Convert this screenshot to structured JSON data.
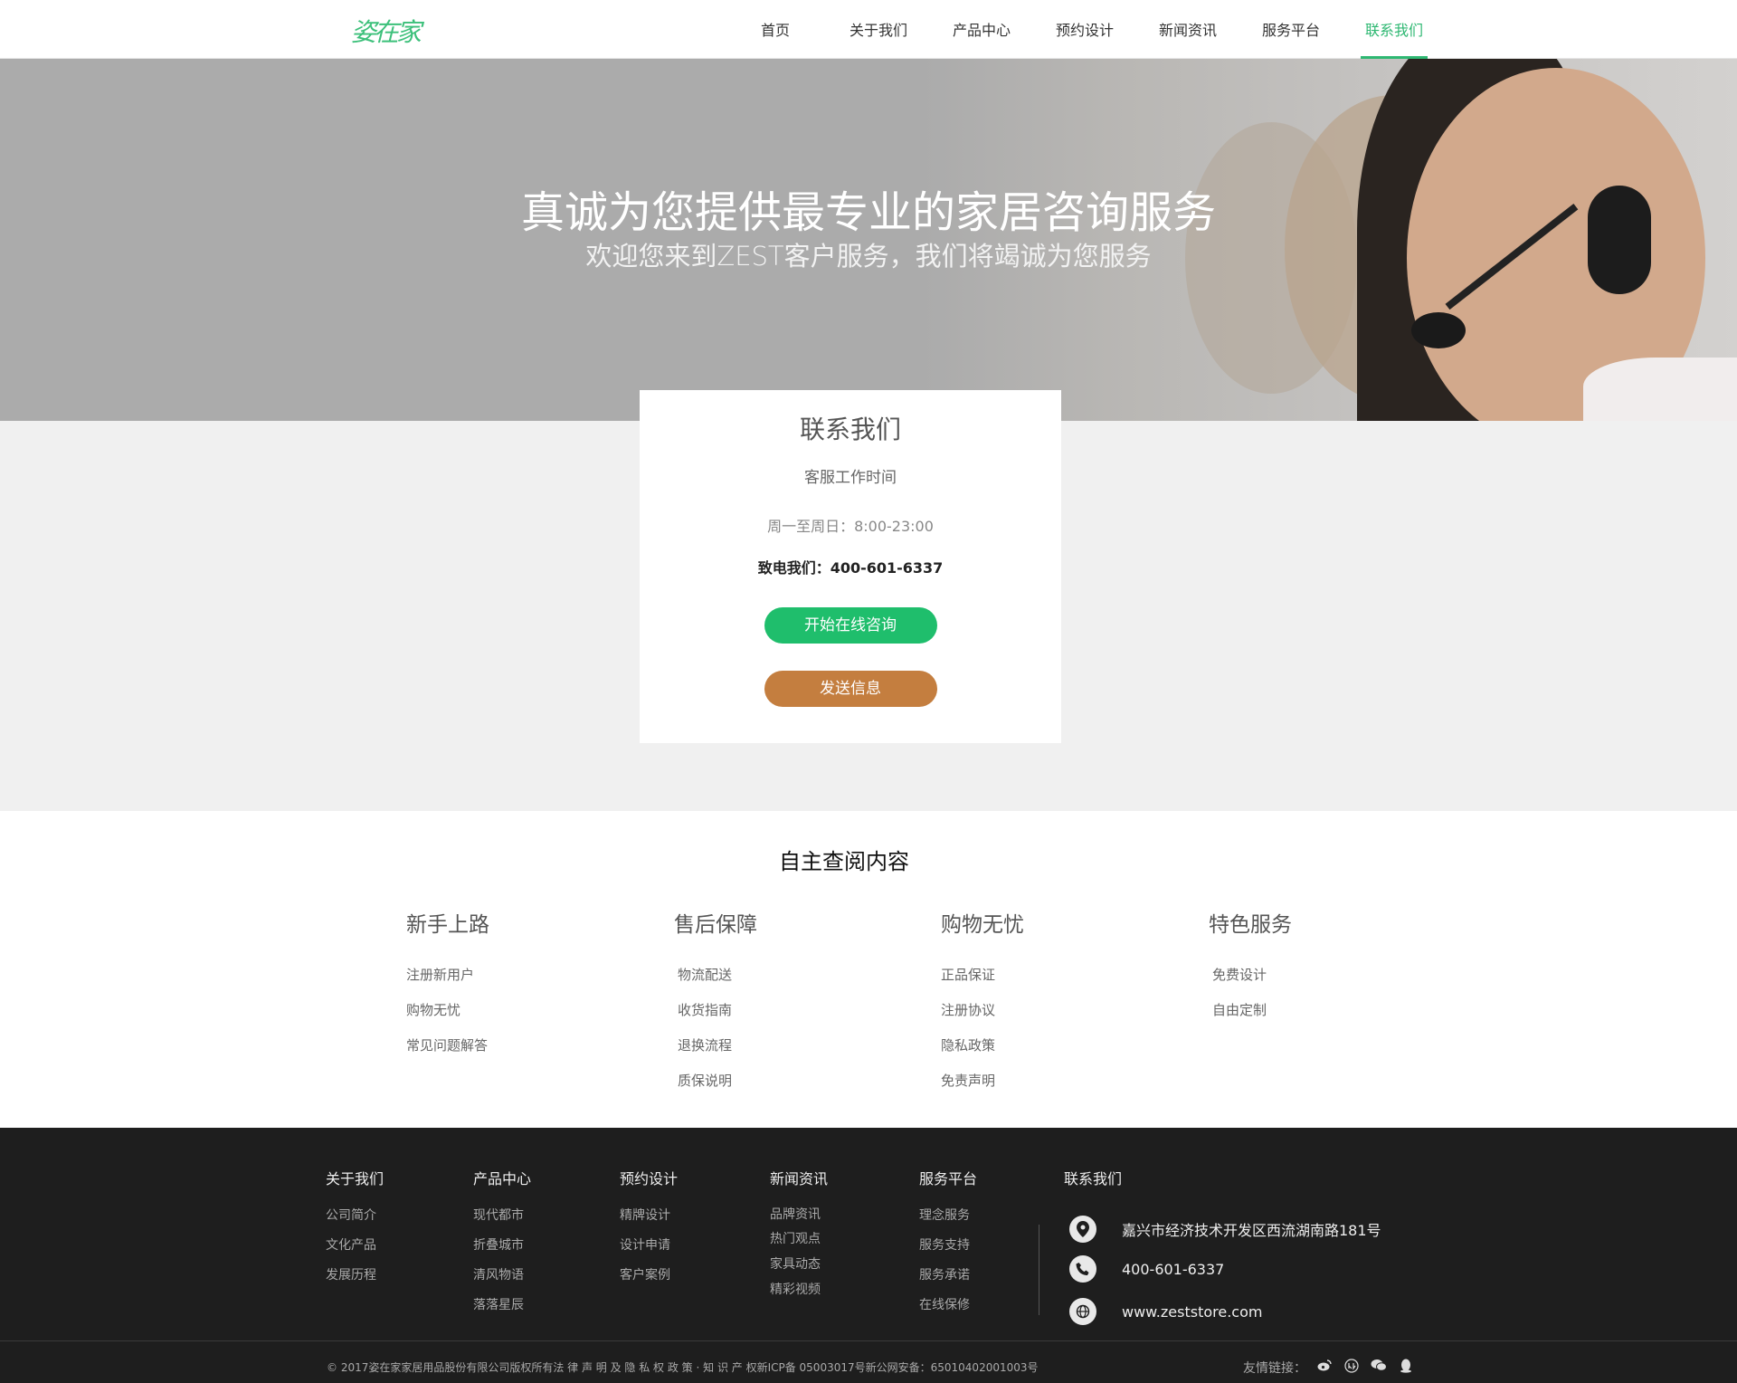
{
  "header": {
    "logo": "姿在家",
    "nav": [
      "首页",
      "关于我们",
      "产品中心",
      "预约设计",
      "新闻资讯",
      "服务平台",
      "联系我们"
    ],
    "active_index": 6
  },
  "hero": {
    "title": "真诚为您提供最专业的家居咨询服务",
    "subtitle": "欢迎您来到ZEST客户服务，我们将竭诚为您服务"
  },
  "contact_card": {
    "title": "联系我们",
    "hours_label": "客服工作时间",
    "hours": "周一至周日：8:00-23:00",
    "phone": "致电我们：400-601-6337",
    "online_button": "开始在线咨询",
    "message_button": "发送信息"
  },
  "selfhelp": {
    "title": "自主查阅内容",
    "columns": [
      {
        "title": "新手上路",
        "links": [
          "注册新用户",
          "购物无忧",
          "常见问题解答"
        ]
      },
      {
        "title": "售后保障",
        "links": [
          "物流配送",
          "收货指南",
          "退换流程",
          "质保说明"
        ]
      },
      {
        "title": "购物无忧",
        "links": [
          "正品保证",
          "注册协议",
          "隐私政策",
          "免责声明"
        ]
      },
      {
        "title": "特色服务",
        "links": [
          "免费设计",
          "自由定制"
        ]
      }
    ]
  },
  "footer": {
    "columns": [
      {
        "title": "关于我们",
        "links": [
          "公司简介",
          "文化产品",
          "发展历程"
        ]
      },
      {
        "title": "产品中心",
        "links": [
          "现代都市",
          "折叠城市",
          "清风物语",
          "落落星辰"
        ]
      },
      {
        "title": "预约设计",
        "links": [
          "精牌设计",
          "设计申请",
          "客户案例"
        ]
      },
      {
        "title": "新闻资讯",
        "links": [
          "品牌资讯",
          "热门观点",
          "家具动态",
          "精彩视频"
        ]
      },
      {
        "title": "服务平台",
        "links": [
          "理念服务",
          "服务支持",
          "服务承诺",
          "在线保修"
        ]
      }
    ],
    "contact_title": "联系我们",
    "address": "嘉兴市经济技术开发区西流湖南路181号",
    "phone": "400-601-6337",
    "website": "www.zeststore.com",
    "copyright": "© 2017姿在家家居用品股份有限公司版权所有法 律 声 明 及 隐 私 权 政 策 · 知 识 产 权新ICP备 05003017号新公网安备：65010402001003号",
    "friend_label": "友情链接：",
    "friend_icons": [
      "weibo-icon",
      "renren-icon",
      "wechat-icon",
      "qq-icon"
    ]
  },
  "colors": {
    "accent": "#2eb872",
    "online_button": "#1fbe6c",
    "message_button": "#c47e3f",
    "footer_bg": "#1e1e1e"
  }
}
